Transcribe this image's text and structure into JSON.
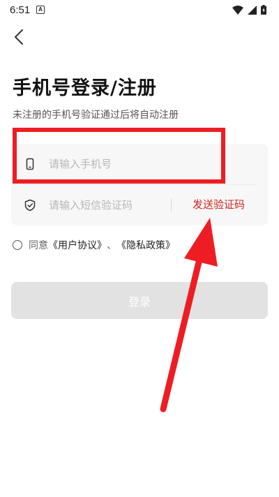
{
  "status_bar": {
    "time": "6:51",
    "notification_glyph": "A",
    "icons": [
      "wifi-icon",
      "signal-icon",
      "battery-icon"
    ]
  },
  "nav": {
    "back_icon": "chevron-left-icon"
  },
  "header": {
    "title": "手机号登录/注册",
    "subtitle": "未注册的手机号验证通过后将自动注册"
  },
  "form": {
    "phone": {
      "icon": "phone-icon",
      "placeholder": "请输入手机号",
      "value": ""
    },
    "code": {
      "icon": "shield-check-icon",
      "placeholder": "请输入短信验证码",
      "value": ""
    },
    "send_code_label": "发送验证码"
  },
  "agreement": {
    "checked": false,
    "prefix": "同意",
    "user_agreement": "《用户协议》",
    "separator": "、",
    "privacy_policy": "《隐私政策》"
  },
  "login_button": {
    "label": "登录",
    "enabled": false
  },
  "colors": {
    "accent_red": "#d2241f",
    "annotation_red": "#ee1d23",
    "card_bg": "#f7f7f7",
    "disabled_button": "#e2e2e2"
  }
}
